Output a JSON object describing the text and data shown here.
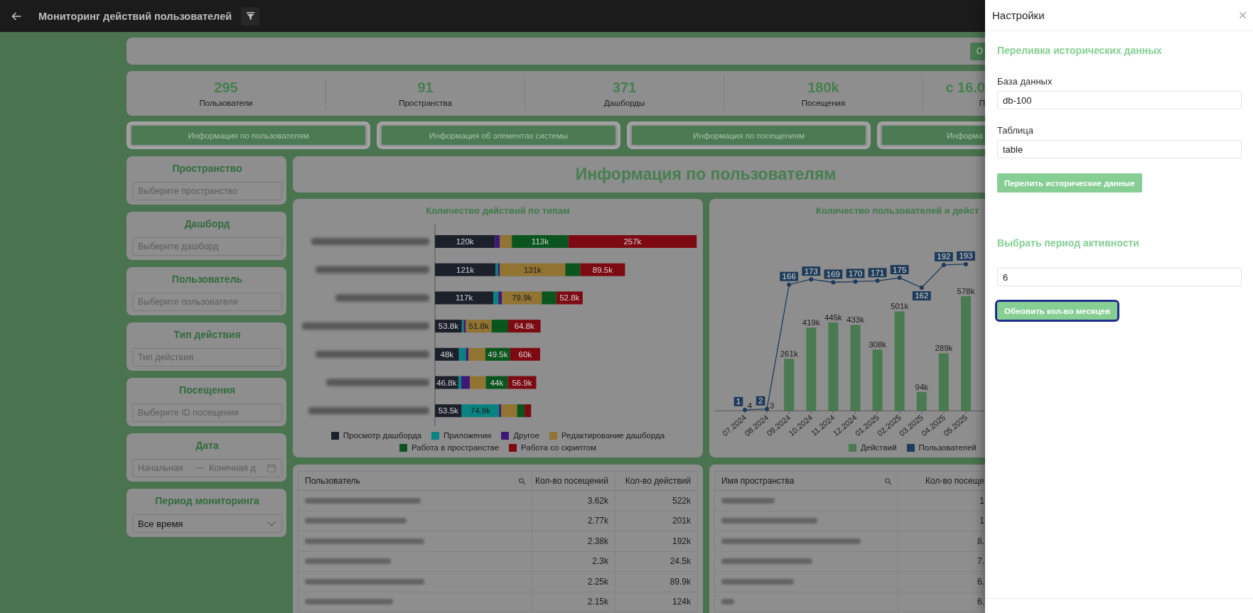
{
  "header": {
    "title": "Мониторинг действий пользователей"
  },
  "filter_bar": {
    "button": "О"
  },
  "kpis": [
    {
      "value": "295",
      "label": "Пользователи"
    },
    {
      "value": "91",
      "label": "Пространства"
    },
    {
      "value": "371",
      "label": "Дашборды"
    },
    {
      "value": "180k",
      "label": "Посещения"
    },
    {
      "value": "с 16.0",
      "label": "П"
    }
  ],
  "nav_buttons": [
    "Информация по пользователям",
    "Информация об элементах системы",
    "Информация по посещениям",
    "Информа"
  ],
  "filters": [
    {
      "title": "Пространство",
      "kind": "select",
      "placeholder": "Выберите пространство"
    },
    {
      "title": "Дашборд",
      "kind": "select",
      "placeholder": "Выберите дашборд"
    },
    {
      "title": "Пользователь",
      "kind": "select",
      "placeholder": "Выберите пользователя"
    },
    {
      "title": "Тип действия",
      "kind": "select",
      "placeholder": "Тип действия"
    },
    {
      "title": "Посещения",
      "kind": "select",
      "placeholder": "Выберите ID посещения"
    },
    {
      "title": "Дата",
      "kind": "date_range",
      "start_placeholder": "Начальная",
      "end_placeholder": "Конечная д"
    },
    {
      "title": "Период мониторинга",
      "kind": "dropdown",
      "value": "Все время"
    }
  ],
  "section_title": "Информация по пользователям",
  "actions_chart": {
    "chart_data": {
      "type": "bar",
      "title": "Количество действий по типам",
      "orientation": "horizontal",
      "stacked": true,
      "series": [
        {
          "name": "Просмотр дашборда",
          "color": "#1b202a",
          "values": [
            120000,
            121000,
            117000,
            53800,
            48000,
            46800,
            53500
          ],
          "value_labels": [
            "120k",
            "121k",
            "117k",
            "53.8k",
            "48k",
            "46.8k",
            "53.5k"
          ]
        },
        {
          "name": "Приложения",
          "color": "#0b8282",
          "values": [
            0,
            5000,
            10000,
            4000,
            14000,
            6000,
            74900
          ],
          "value_labels": [
            null,
            null,
            null,
            null,
            null,
            null,
            "74.9k"
          ]
        },
        {
          "name": "Другое",
          "color": "#3c1978",
          "values": [
            10000,
            4000,
            7000,
            4000,
            5000,
            17000,
            4000
          ],
          "value_labels": [
            null,
            null,
            null,
            null,
            null,
            null,
            null
          ]
        },
        {
          "name": "Редактирование дашборда",
          "color": "#917332",
          "values": [
            24000,
            131000,
            79900,
            51800,
            34000,
            32000,
            32000
          ],
          "value_labels": [
            null,
            "131k",
            "79.9k",
            "51.8k",
            null,
            null,
            null
          ]
        },
        {
          "name": "Работа в пространстве",
          "color": "#0a551e",
          "values": [
            113000,
            30000,
            29000,
            33000,
            49500,
            44000,
            15000
          ],
          "value_labels": [
            "113k",
            null,
            null,
            null,
            "49.5k",
            "44k",
            null
          ]
        },
        {
          "name": "Работа со скриптом",
          "color": "#7d0a12",
          "values": [
            257000,
            89500,
            52800,
            64800,
            60000,
            56900,
            13000
          ],
          "value_labels": [
            "257k",
            "89.5k",
            "52.8k",
            "64.8k",
            "60k",
            "56.9k",
            null
          ]
        }
      ]
    }
  },
  "users_chart": {
    "bars": {
      "chart_data": {
        "type": "bar",
        "title": "Количество пользователей и дейст",
        "categories": [
          "07.2024",
          "08.2024",
          "09.2024",
          "10.2024",
          "11.2024",
          "12.2024",
          "01.2025",
          "02.2025",
          "03.2025",
          "04.2025",
          "05.2025"
        ],
        "series": [
          {
            "name": "Действий",
            "color": "#4a7a50",
            "values": [
              4,
              3,
              261000,
              419000,
              445000,
              433000,
              308000,
              501000,
              94000,
              289000,
              578000
            ],
            "value_labels": [
              "4",
              "3",
              "261k",
              "419k",
              "445k",
              "433k",
              "308k",
              "501k",
              "94k",
              "289k",
              "578k"
            ]
          }
        ]
      }
    },
    "line": {
      "chart_data": {
        "type": "line",
        "data_labels": true,
        "series": [
          {
            "name": "Пользователей",
            "color": "#1f3b58",
            "marker": "circle",
            "values": [
              1,
              2,
              166,
              173,
              169,
              170,
              171,
              175,
              162,
              192,
              193
            ]
          }
        ]
      }
    }
  },
  "users_table": {
    "columns": [
      {
        "label": "Пользователь",
        "searchable": true
      },
      {
        "label": "Кол-во посещений",
        "searchable": false
      },
      {
        "label": "Кол-во действий",
        "searchable": false
      }
    ],
    "rows": [
      [
        "",
        "3.62k",
        "522k"
      ],
      [
        "",
        "2.77k",
        "201k"
      ],
      [
        "",
        "2.38k",
        "192k"
      ],
      [
        "",
        "2.3k",
        "24.5k"
      ],
      [
        "",
        "2.25k",
        "89.9k"
      ],
      [
        "",
        "2.15k",
        "124k"
      ]
    ]
  },
  "spaces_table": {
    "columns": [
      {
        "label": "Имя пространства",
        "searchable": true
      },
      {
        "label": "Кол-во посеще",
        "searchable": false
      }
    ],
    "rows": [
      [
        "",
        "1"
      ],
      [
        "",
        "1"
      ],
      [
        "",
        "8."
      ],
      [
        "",
        "7."
      ],
      [
        "",
        "6."
      ],
      [
        "",
        "6."
      ]
    ]
  },
  "settings": {
    "title": "Настройки",
    "sections": [
      {
        "heading": "Переливка исторических данных",
        "fields": [
          {
            "label": "База данных",
            "value": "db-100"
          },
          {
            "label": "Таблица",
            "value": "table"
          }
        ],
        "button": {
          "label": "Перелить исторические данные",
          "focused": false
        }
      },
      {
        "heading": "Выбрать период активности",
        "fields": [
          {
            "value": "6"
          }
        ],
        "button": {
          "label": "Обновить кол-во месяцев",
          "focused": true
        }
      }
    ]
  }
}
